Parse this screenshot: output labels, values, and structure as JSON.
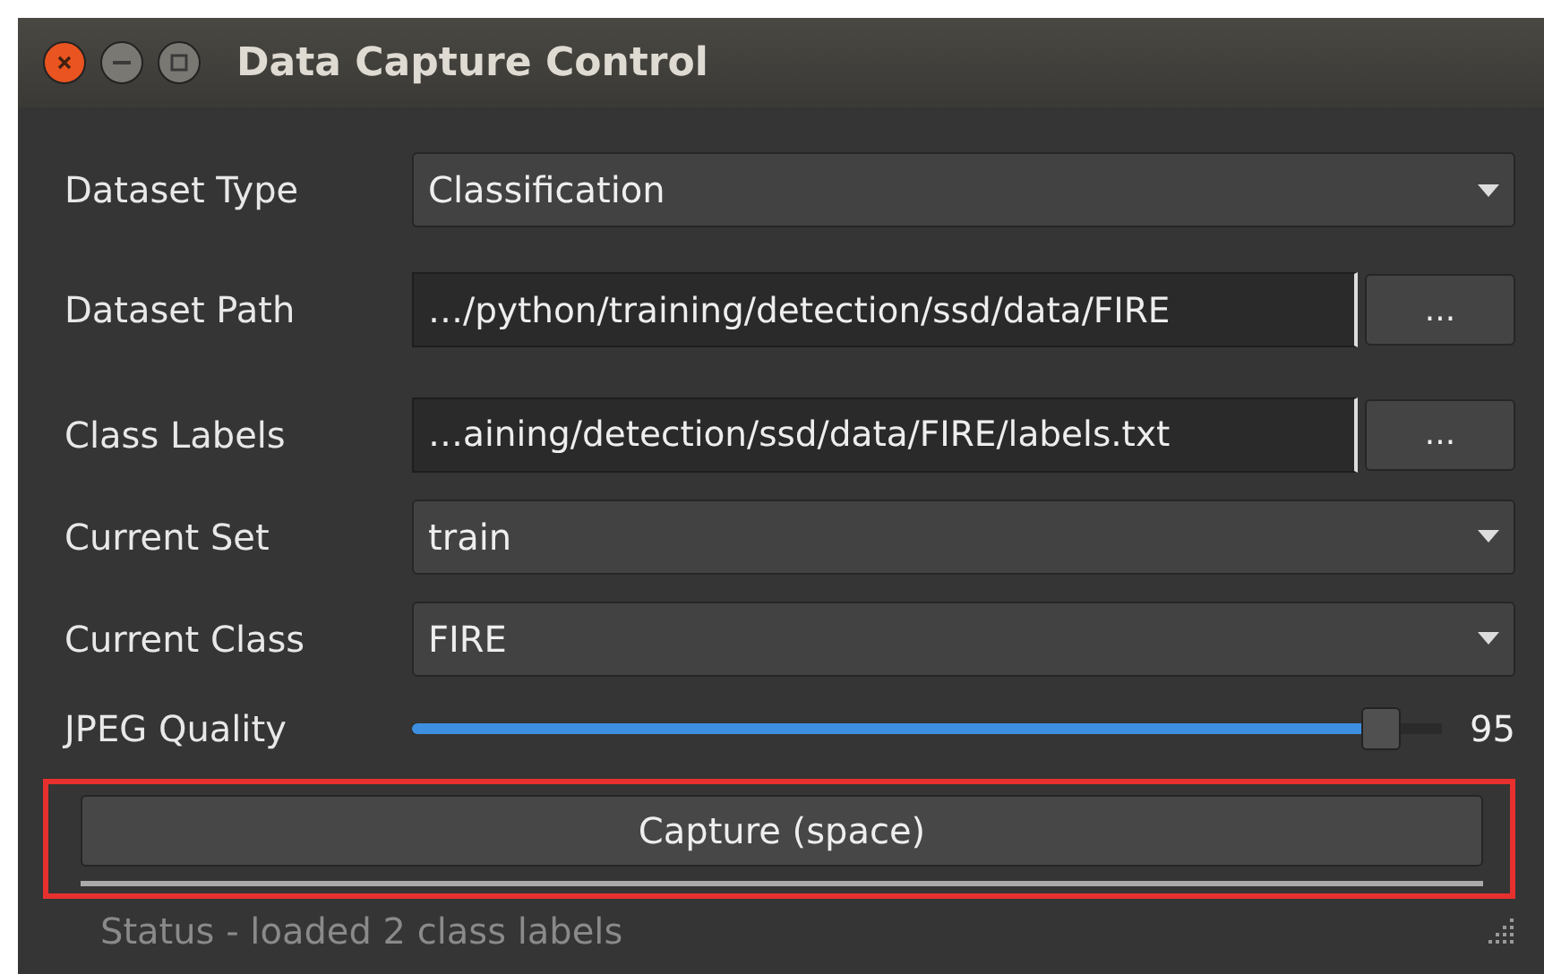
{
  "window": {
    "title": "Data Capture Control"
  },
  "rows": [
    {
      "kind": "dropdown",
      "label": "Dataset Type",
      "value": "Classification"
    },
    {
      "kind": "path",
      "label": "Dataset Path",
      "value": "…/python/training/detection/ssd/data/FIRE",
      "button": "..."
    },
    {
      "kind": "path",
      "label": "Class Labels",
      "value": "…aining/detection/ssd/data/FIRE/labels.txt",
      "button": "..."
    },
    {
      "kind": "dropdown",
      "label": "Current Set",
      "value": "train"
    },
    {
      "kind": "dropdown",
      "label": "Current Class",
      "value": "FIRE"
    },
    {
      "kind": "slider",
      "label": "JPEG Quality",
      "level": 0.94,
      "reading": "95"
    }
  ],
  "capture_button": "Capture (space)",
  "status": "Status - loaded 2 class labels"
}
